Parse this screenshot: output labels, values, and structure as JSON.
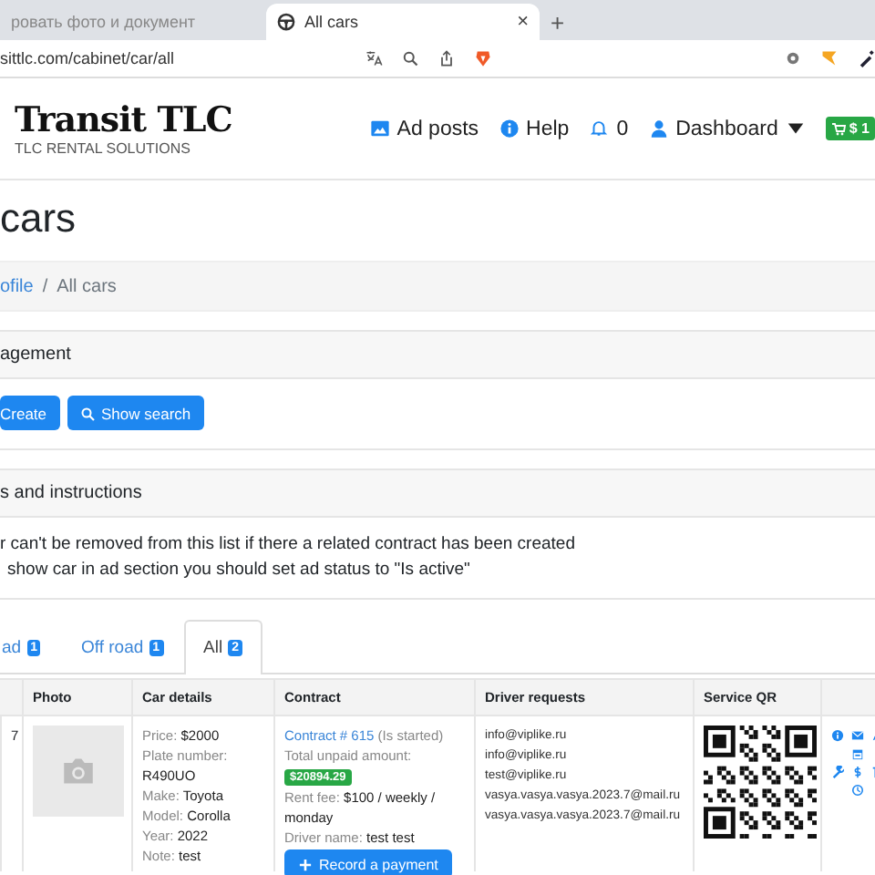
{
  "browser": {
    "tabs": [
      {
        "title": "ровать фото и документ",
        "selected": false
      },
      {
        "title": "All cars",
        "selected": true
      }
    ],
    "new_tab": "+",
    "close": "×",
    "address": "sittlc.com/cabinet/car/all"
  },
  "header": {
    "logo": "Transit TLC",
    "tagline": "TLC RENTAL SOLUTIONS",
    "nav": [
      {
        "kind": "ad",
        "label": "Ad posts"
      },
      {
        "kind": "help",
        "label": "Help"
      },
      {
        "kind": "bell",
        "label": "0"
      },
      {
        "kind": "user",
        "label": "Dashboard"
      }
    ],
    "cart": "$ 1"
  },
  "page_title": "cars",
  "breadcrumb": [
    {
      "label": "ofile",
      "link": true
    },
    {
      "label": "All cars",
      "link": false
    }
  ],
  "breadcrumb_separator": "/",
  "management": {
    "title": "agement",
    "buttons": [
      {
        "kind": "create",
        "label": "Create"
      },
      {
        "kind": "search",
        "label": "Show search"
      }
    ]
  },
  "instructions": {
    "title": "s and instructions",
    "lines": [
      "r can't be removed from this list if there a related contract has been created",
      "show car in ad section you should set ad status to \"Is active\""
    ]
  },
  "tabs": [
    {
      "label": "ad",
      "count": "1",
      "selected": false
    },
    {
      "label": "Off road",
      "count": "1",
      "selected": false
    },
    {
      "label": "All",
      "count": "2",
      "selected": true
    }
  ],
  "table": {
    "columns": [
      "",
      "Photo",
      "Car details",
      "Contract",
      "Driver requests",
      "Service QR",
      ""
    ],
    "rows": [
      {
        "id": "7",
        "details": [
          {
            "label": "Price:",
            "value": "$2000"
          },
          {
            "label": "Plate number:",
            "value": "R490UO"
          },
          {
            "label": "Make:",
            "value": "Toyota"
          },
          {
            "label": "Model:",
            "value": "Corolla"
          },
          {
            "label": "Year:",
            "value": "2022"
          },
          {
            "label": "Note:",
            "value": "test"
          }
        ],
        "contract": {
          "link": "Contract # 615",
          "status": "(Is started)",
          "unpaid_label": "Total unpaid amount:",
          "unpaid": "$20894.29",
          "rent_label": "Rent fee:",
          "rent": "$100 / weekly / monday",
          "driver_label": "Driver name:",
          "driver": "test test",
          "button": "Record a payment"
        },
        "requests": [
          "info@viplike.ru",
          "info@viplike.ru",
          "test@viplike.ru",
          "vasya.vasya.vasya.2023.7@mail.ru",
          "vasya.vasya.vasya.2023.7@mail.ru"
        ]
      }
    ]
  }
}
